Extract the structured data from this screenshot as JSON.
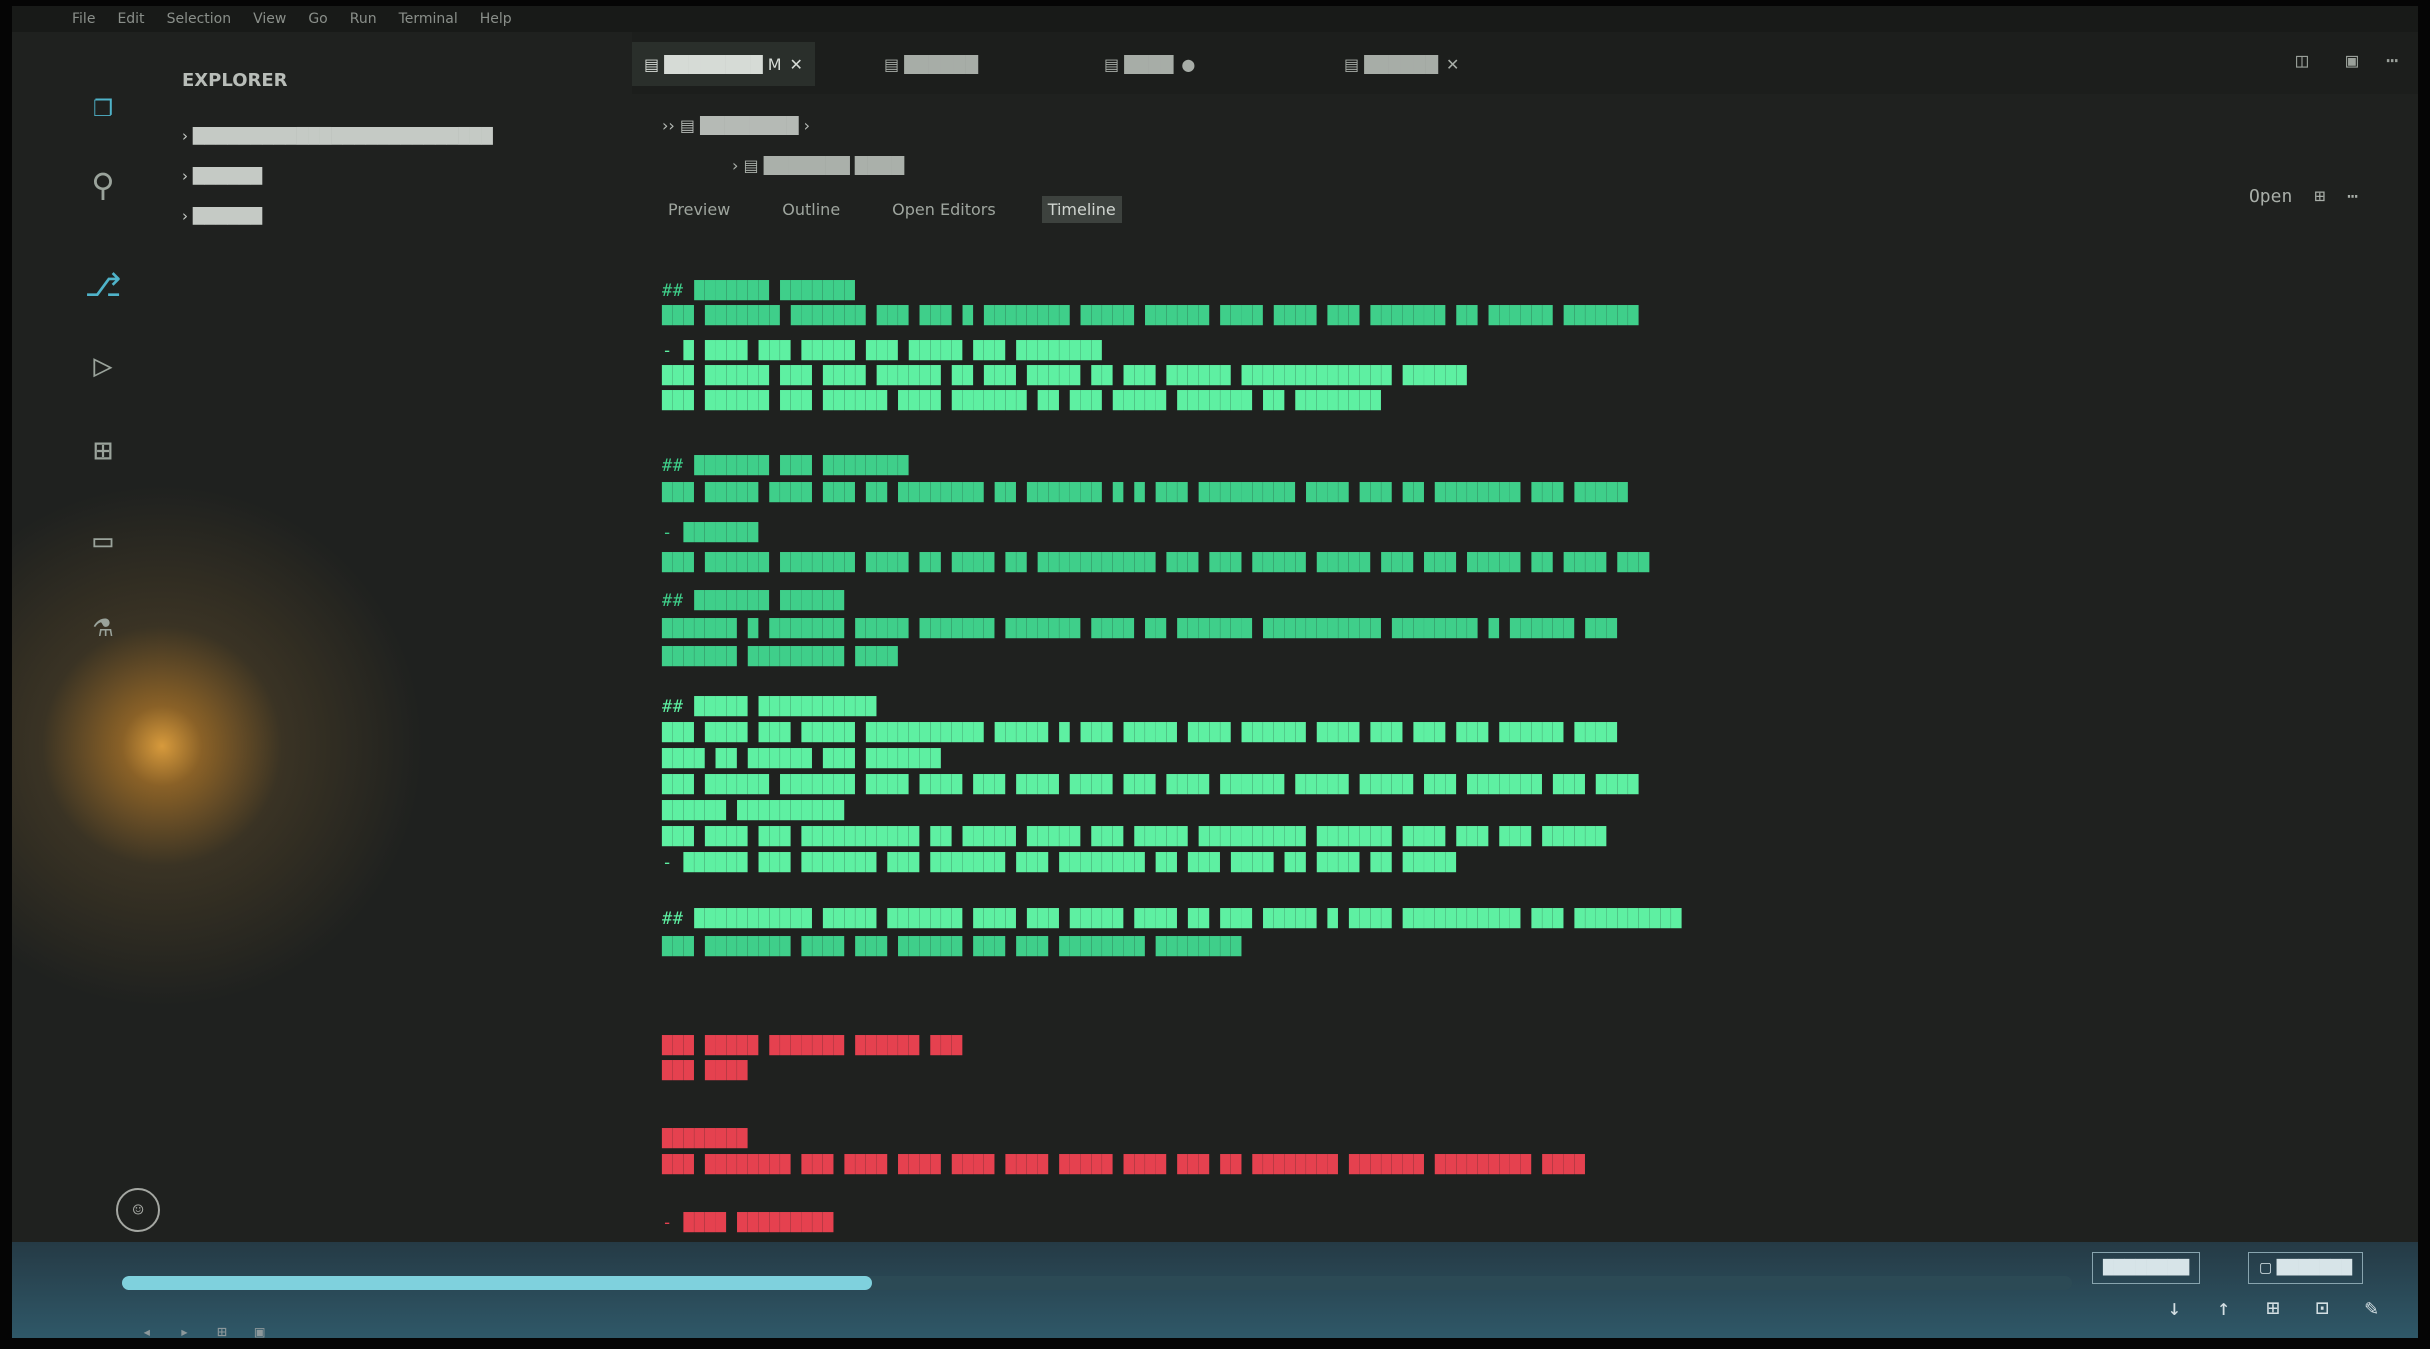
{
  "menubar": {
    "items": [
      "File",
      "Edit",
      "Selection",
      "View",
      "Go",
      "Run",
      "Terminal",
      "Help"
    ]
  },
  "sidebar": {
    "title": "EXPLORER",
    "rows": [
      "› ██████████████████████████",
      "› ██████",
      "› ██████"
    ]
  },
  "tabs": {
    "items": [
      {
        "label": "▤ ████████ M",
        "close": "✕"
      },
      {
        "label": "▤ ██████",
        "close": ""
      },
      {
        "label": "▤ ████",
        "close": "●"
      },
      {
        "label": "▤ ██████",
        "close": "✕"
      }
    ]
  },
  "breadcrumb": {
    "path": "›› ▤ ████████ ›",
    "sub": "› ▤ ███████ ████"
  },
  "subtabs": [
    "Preview",
    "Outline",
    "Open Editors",
    "Timeline"
  ],
  "editor_tools": [
    "Open",
    "⊞",
    "⋯"
  ],
  "editor": {
    "green_lines": [
      "   ## ███████ ███████",
      "     ███ ███████ ███████ ███ ███ █ ████████ █████ ██████ ████ ████ ███ ███████ ██ ██████ ███████",
      "- █ ████ ███ █████ ███ █████ ███ ████████",
      "        ███ ██████ ███ ████ ██████ ██ ███ █████ ██ ███ ██████ ██████████████ ██████",
      "        ███ ██████ ███ ██████ ████ ███████ ██ ███ █████ ███████ ██ ████████",
      "   ## ███████ ███ ████████",
      "     ███ █████ ████ ███ ██ ████████ ██ ███████ █ █ ███ █████████ ████ ███ ██ ████████ ███ █████",
      "- ███████",
      "     ███ ██████ ███████ ████ ██ ████ ██ ███████████ ███ ███ █████ █████ ███ ███ █████ ██ ████ ███",
      "## ███████ ██████",
      "     ███████ █ ███████ █████ ███████ ███████ ████ ██ ███████ ███████████ ████████ █ ██████ ███",
      "     ███████ █████████ ████",
      "   ## █████ ███████████",
      "     ███ ████ ███ █████ ███████████ █████ █ ███ █████ ████ ██████ ████ ███ ███ ███ ██████ ████",
      "     ████ ██ ██████ ███ ███████",
      "     ███ ██████ ███████ ████ ████ ███ ████ ████ ███ ████ ██████ █████ █████ ███ ███████ ███ ████",
      "     ██████ ██████████",
      "       ███ ████ ███ ███████████ ██ █████ █████ ███ █████ ██████████ ███████ ████ ███ ███ ██████",
      "- ██████ ███ ███████ ███ ███████ ███ ████████ ██ ███ ████ ██ ████ ██ █████",
      "## ███████████ █████ ███████ ████ ███ █████ ████ ██ ███ █████ █ ████ ███████████ ███ ██████████",
      "   ███ ████████ ████ ███ ██████ ███ ███ ████████ ████████"
    ],
    "red_lines": [
      "███ █████ ███████ ██████ ███",
      "███ ████",
      "  ████████",
      "    ███ ████████ ███ ████ ████ ████ ████ █████ ████ ███ ██ ████████ ███████ █████████ ████",
      "- ████ █████████"
    ]
  },
  "statusbar": {
    "buttons": [
      "████████",
      "▢ ███████"
    ],
    "icons": [
      "↓",
      "↑",
      "⊞",
      "⊡",
      "✎"
    ]
  },
  "bottom_icons": [
    "◂",
    "▸",
    "⊞",
    "▣"
  ]
}
